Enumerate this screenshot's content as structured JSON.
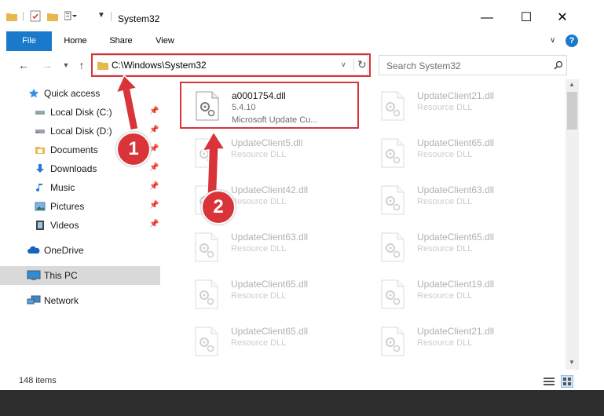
{
  "window": {
    "title": "System32",
    "minimize": "—",
    "maximize": "☐",
    "close": "✕"
  },
  "ribbon": {
    "tabs": [
      "File",
      "Home",
      "Share",
      "View"
    ],
    "help": "?"
  },
  "address": {
    "path": "C:\\Windows\\System32",
    "search_placeholder": "Search System32"
  },
  "nav": {
    "quick_access": "Quick access",
    "items": [
      {
        "label": "Local Disk (C:)",
        "icon": "drive-icon"
      },
      {
        "label": "Local Disk (D:)",
        "icon": "drive-icon"
      },
      {
        "label": "Documents",
        "icon": "documents-icon"
      },
      {
        "label": "Downloads",
        "icon": "downloads-icon"
      },
      {
        "label": "Music",
        "icon": "music-icon"
      },
      {
        "label": "Pictures",
        "icon": "pictures-icon"
      },
      {
        "label": "Videos",
        "icon": "videos-icon"
      }
    ],
    "onedrive": "OneDrive",
    "thispc": "This PC",
    "network": "Network"
  },
  "files": [
    {
      "name": "a0001754.dll",
      "line2": "5.4.10",
      "line3": "Microsoft Update Cu...",
      "faded": false
    },
    {
      "name": "UpdateClient21.dll",
      "line2": "Resource DLL",
      "faded": true
    },
    {
      "name": "UpdateClient5.dll",
      "line2": "Resource DLL",
      "faded": true
    },
    {
      "name": "UpdateClient65.dll",
      "line2": "Resource DLL",
      "faded": true
    },
    {
      "name": "UpdateClient42.dll",
      "line2": "Resource DLL",
      "faded": true
    },
    {
      "name": "UpdateClient63.dll",
      "line2": "Resource DLL",
      "faded": true
    },
    {
      "name": "UpdateClient63.dll",
      "line2": "Resource DLL",
      "faded": true
    },
    {
      "name": "UpdateClient65.dll",
      "line2": "Resource DLL",
      "faded": true
    },
    {
      "name": "UpdateClient65.dll",
      "line2": "Resource DLL",
      "faded": true
    },
    {
      "name": "UpdateClient19.dll",
      "line2": "Resource DLL",
      "faded": true
    },
    {
      "name": "UpdateClient65.dll",
      "line2": "Resource DLL",
      "faded": true
    },
    {
      "name": "UpdateClient21.dll",
      "line2": "Resource DLL",
      "faded": true
    }
  ],
  "status": {
    "items": "148 items"
  },
  "annotations": {
    "step1": "1",
    "step2": "2"
  },
  "colors": {
    "accent": "#1979ca",
    "highlight": "#d9343a"
  }
}
